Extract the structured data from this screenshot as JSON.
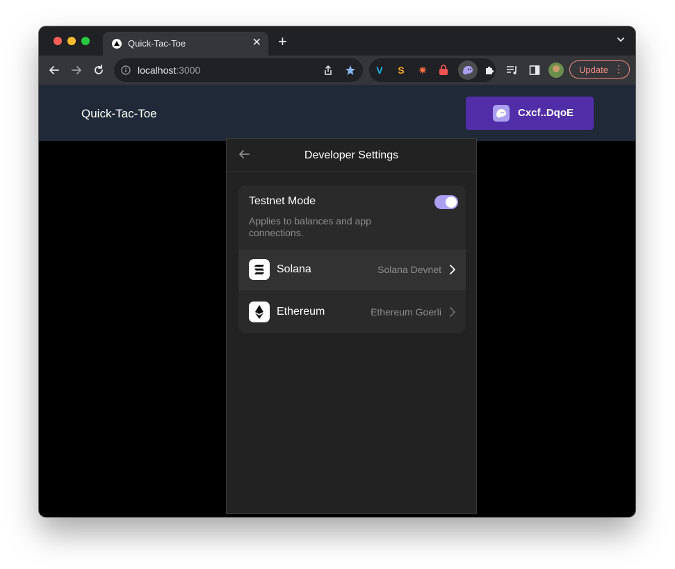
{
  "browser": {
    "tab_title": "Quick-Tac-Toe",
    "tab_close": "✕",
    "new_tab": "+",
    "address": {
      "host": "localhost",
      "port": ":3000"
    },
    "update_label": "Update",
    "menu_dots": "⋮"
  },
  "page": {
    "site_title": "Quick-Tac-Toe",
    "wallet_button": "Cxcf..DqoE"
  },
  "popup": {
    "title": "Developer Settings",
    "testnet": {
      "title": "Testnet Mode",
      "description": "Applies to balances and app connections.",
      "enabled": true
    },
    "chains": [
      {
        "name": "Solana",
        "network": "Solana Devnet"
      },
      {
        "name": "Ethereum",
        "network": "Ethereum Goerli"
      }
    ]
  },
  "colors": {
    "accent_purple": "#ab9ff2",
    "wallet_button_bg": "#512da8",
    "update_red": "#f28b82",
    "header_bg": "#1f2937"
  }
}
